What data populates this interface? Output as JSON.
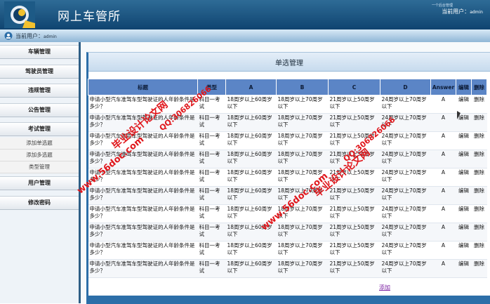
{
  "header": {
    "title": "网上车管所",
    "tag": "一个后台管理",
    "current_user_label": "当前用户：",
    "current_user_name": "admin"
  },
  "subbar": {
    "current_user_label": "当前用户：",
    "current_user_name": "admin"
  },
  "sidebar": {
    "menus": [
      {
        "label": "车辆管理"
      },
      {
        "label": "驾驶员管理"
      },
      {
        "label": "违规管理"
      },
      {
        "label": "公告管理"
      },
      {
        "label": "考试管理"
      },
      {
        "label": "用户管理"
      },
      {
        "label": "修改密码"
      }
    ],
    "exam_sub": [
      {
        "label": "添加单选题"
      },
      {
        "label": "添加多选题"
      },
      {
        "label": "类型管理"
      }
    ]
  },
  "panel": {
    "title": "单选管理",
    "add_label": "添加"
  },
  "table": {
    "headers": {
      "title": "标题",
      "type": "类型",
      "a": "A",
      "b": "B",
      "c": "C",
      "d": "D",
      "answer": "Answer",
      "edit": "编辑",
      "delete": "删除"
    },
    "rows": [
      {
        "title": "申请小型汽车准驾车型驾驶证的人年龄条件是多少？",
        "type": "科目一考试",
        "a": "18周岁以上60周岁以下",
        "b": "18周岁以上70周岁以下",
        "c": "21周岁以上50周岁以下",
        "d": "24周岁以上70周岁以下",
        "answer": "A",
        "edit": "编辑",
        "delete": "删除"
      },
      {
        "title": "申请小型汽车准驾车型驾驶证的人年龄条件是多少？",
        "type": "科目一考试",
        "a": "18周岁以上60周岁以下",
        "b": "18周岁以上70周岁以下",
        "c": "21周岁以上50周岁以下",
        "d": "24周岁以上70周岁以下",
        "answer": "A",
        "edit": "编辑",
        "delete": "删除"
      },
      {
        "title": "申请小型汽车准驾车型驾驶证的人年龄条件是多少？",
        "type": "科目一考试",
        "a": "18周岁以上60周岁以下",
        "b": "18周岁以上70周岁以下",
        "c": "21周岁以上50周岁以下",
        "d": "24周岁以上70周岁以下",
        "answer": "A",
        "edit": "编辑",
        "delete": "删除"
      },
      {
        "title": "申请小型汽车准驾车型驾驶证的人年龄条件是多少？",
        "type": "科目一考试",
        "a": "18周岁以上60周岁以下",
        "b": "18周岁以上70周岁以下",
        "c": "21周岁以上50周岁以下",
        "d": "24周岁以上70周岁以下",
        "answer": "A",
        "edit": "编辑",
        "delete": "删除"
      },
      {
        "title": "申请小型汽车准驾车型驾驶证的人年龄条件是多少？",
        "type": "科目一考试",
        "a": "18周岁以上60周岁以下",
        "b": "18周岁以上70周岁以下",
        "c": "21周岁以上50周岁以下",
        "d": "24周岁以上70周岁以下",
        "answer": "A",
        "edit": "编辑",
        "delete": "删除"
      },
      {
        "title": "申请小型汽车准驾车型驾驶证的人年龄条件是多少？",
        "type": "科目一考试",
        "a": "18周岁以上60周岁以下",
        "b": "18周岁以上70周岁以下",
        "c": "21周岁以上50周岁以下",
        "d": "24周岁以上70周岁以下",
        "answer": "A",
        "edit": "编辑",
        "delete": "删除"
      },
      {
        "title": "申请小型汽车准驾车型驾驶证的人年龄条件是多少？",
        "type": "科目一考试",
        "a": "18周岁以上60周岁以下",
        "b": "18周岁以上70周岁以下",
        "c": "21周岁以上50周岁以下",
        "d": "24周岁以上70周岁以下",
        "answer": "A",
        "edit": "编辑",
        "delete": "删除"
      },
      {
        "title": "申请小型汽车准驾车型驾驶证的人年龄条件是多少？",
        "type": "科目一考试",
        "a": "18周岁以上60周岁以下",
        "b": "18周岁以上70周岁以下",
        "c": "21周岁以上50周岁以下",
        "d": "24周岁以上70周岁以下",
        "answer": "A",
        "edit": "编辑",
        "delete": "删除"
      },
      {
        "title": "申请小型汽车准驾车型驾驶证的人年龄条件是多少？",
        "type": "科目一考试",
        "a": "18周岁以上60周岁以下",
        "b": "18周岁以上70周岁以下",
        "c": "21周岁以上50周岁以下",
        "d": "24周岁以上70周岁以下",
        "answer": "A",
        "edit": "编辑",
        "delete": "删除"
      },
      {
        "title": "申请小型汽车准驾车型驾驶证的人年龄条件是多少？",
        "type": "科目一考试",
        "a": "18周岁以上60周岁以下",
        "b": "18周岁以上70周岁以下",
        "c": "21周岁以上50周岁以下",
        "d": "24周岁以上70周岁以下",
        "answer": "A",
        "edit": "编辑",
        "delete": "删除"
      }
    ]
  },
  "watermarks": [
    {
      "text": "毕业设计论文网"
    },
    {
      "text": "www.56doc.com"
    },
    {
      "text": "QQ:306826066"
    },
    {
      "text": "毕业设计论文网"
    },
    {
      "text": "www.56doc.com"
    },
    {
      "text": "QQ:306826066"
    }
  ],
  "colors": {
    "header": "#0f4470",
    "table_header": "#5b85c6",
    "accent": "#2c6ea8",
    "watermark": "#e0161b",
    "add_link": "#7b1fa2"
  }
}
